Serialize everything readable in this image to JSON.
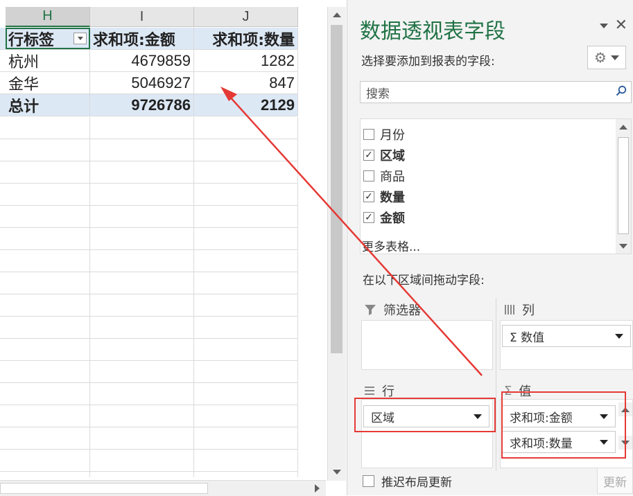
{
  "sheet": {
    "columns": [
      "H",
      "I",
      "J"
    ],
    "header": {
      "row_label": "行标签",
      "sum_amount": "求和项:金额",
      "sum_qty": "求和项:数量"
    },
    "rows": [
      {
        "label": "杭州",
        "amount": "4679859",
        "qty": "1282"
      },
      {
        "label": "金华",
        "amount": "5046927",
        "qty": "847"
      }
    ],
    "total": {
      "label": "总计",
      "amount": "9726786",
      "qty": "2129"
    }
  },
  "pane": {
    "title": "数据透视表字段",
    "choose_label": "选择要添加到报表的字段:",
    "search_placeholder": "搜索",
    "fields": [
      {
        "label": "月份",
        "checked": false,
        "bold": false
      },
      {
        "label": "区域",
        "checked": true,
        "bold": true
      },
      {
        "label": "商品",
        "checked": false,
        "bold": false
      },
      {
        "label": "数量",
        "checked": true,
        "bold": true
      },
      {
        "label": "金额",
        "checked": true,
        "bold": true
      }
    ],
    "more_tables": "更多表格...",
    "drag_label": "在以下区域间拖动字段:",
    "areas": {
      "filters": "筛选器",
      "columns": "列",
      "rows": "行",
      "values": "值",
      "columns_item": "Σ 数值",
      "rows_item": "区域",
      "values_items": [
        "求和项:金额",
        "求和项:数量"
      ]
    },
    "defer_label": "推迟布局更新",
    "update_label": "更新"
  },
  "colors": {
    "excel_green": "#217346",
    "highlight_red": "#e53935",
    "header_fill": "#dde8f5"
  },
  "icons": [
    "filter-icon",
    "gear-icon",
    "search-icon",
    "close-icon",
    "columns-icon",
    "rows-icon",
    "sigma-icon"
  ]
}
